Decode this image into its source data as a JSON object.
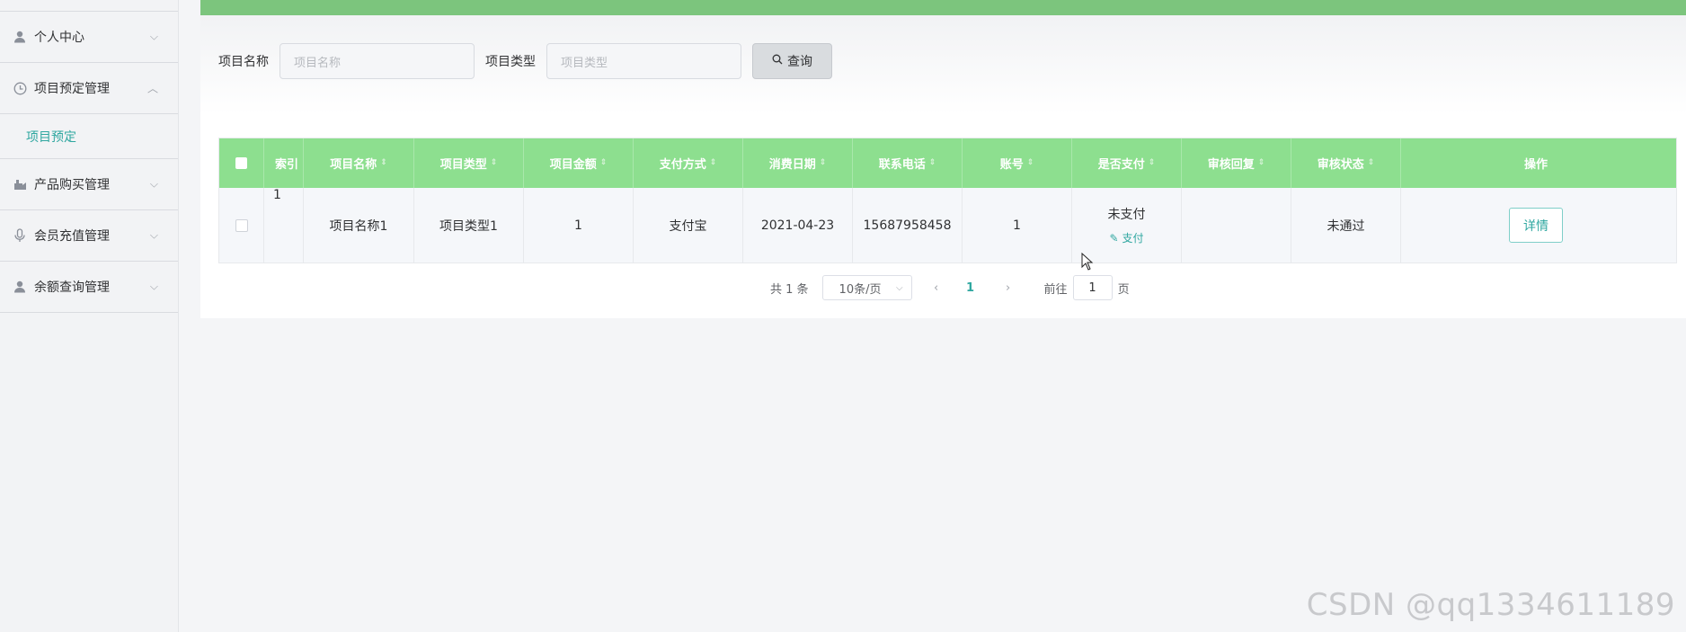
{
  "sidebar": {
    "items": [
      {
        "label": "个人中心",
        "icon": "user-icon",
        "arrow": "chevron-down-icon"
      },
      {
        "label": "项目预定管理",
        "icon": "clock-icon",
        "arrow": "chevron-up-icon"
      },
      {
        "label": "项目预定",
        "submenu": true
      },
      {
        "label": "产品购买管理",
        "icon": "cart-icon",
        "arrow": "chevron-down-icon"
      },
      {
        "label": "会员充值管理",
        "icon": "mic-icon",
        "arrow": "chevron-down-icon"
      },
      {
        "label": "余额查询管理",
        "icon": "user-icon",
        "arrow": "chevron-down-icon"
      }
    ]
  },
  "search": {
    "name_label": "项目名称",
    "name_placeholder": "项目名称",
    "type_label": "项目类型",
    "type_placeholder": "项目类型",
    "button_label": "查询"
  },
  "table": {
    "headers": [
      "索引",
      "项目名称",
      "项目类型",
      "项目金额",
      "支付方式",
      "消费日期",
      "联系电话",
      "账号",
      "是否支付",
      "审核回复",
      "审核状态",
      "操作"
    ],
    "rows": [
      {
        "index": "1",
        "name": "项目名称1",
        "type": "项目类型1",
        "amount": "1",
        "pay_method": "支付宝",
        "date": "2021-04-23",
        "phone": "15687958458",
        "account": "1",
        "paid": "未支付",
        "pay_link": "支付",
        "reply": "",
        "status": "未通过",
        "action": "详情"
      }
    ]
  },
  "pagination": {
    "total": "共 1 条",
    "page_size": "10条/页",
    "current": "1",
    "goto_label": "前往",
    "goto_value": "1",
    "page_suffix": "页"
  },
  "watermark": "CSDN @qq1334611189",
  "colors": {
    "header_green": "#8ddf8f",
    "topbar_green": "#7cc57d",
    "accent_teal": "#2fa7a0"
  }
}
